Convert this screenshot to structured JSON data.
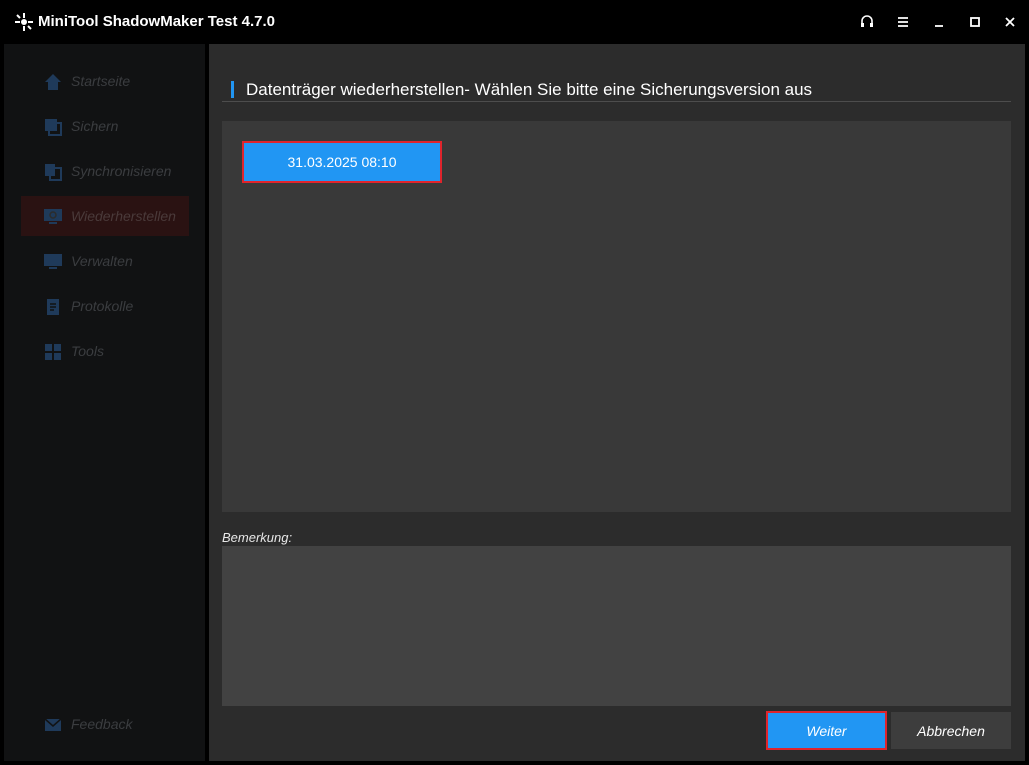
{
  "window": {
    "title": "MiniTool ShadowMaker Test 4.7.0",
    "controls": [
      "headset-icon",
      "menu-icon",
      "minimize-icon",
      "maximize-icon",
      "close-icon"
    ]
  },
  "sidebar": {
    "items": [
      {
        "label": "Startseite",
        "icon": "home-icon",
        "active": false
      },
      {
        "label": "Sichern",
        "icon": "backup-icon",
        "active": false
      },
      {
        "label": "Synchronisieren",
        "icon": "sync-icon",
        "active": false
      },
      {
        "label": "Wiederherstellen",
        "icon": "restore-icon",
        "active": true
      },
      {
        "label": "Verwalten",
        "icon": "manage-icon",
        "active": false
      },
      {
        "label": "Protokolle",
        "icon": "logs-icon",
        "active": false
      },
      {
        "label": "Tools",
        "icon": "tools-icon",
        "active": false
      }
    ],
    "feedback": {
      "label": "Feedback",
      "icon": "mail-icon"
    }
  },
  "main": {
    "heading": "Datenträger wiederherstellen- Wählen Sie bitte eine Sicherungsversion aus",
    "versions": [
      "31.03.2025 08:10"
    ],
    "remark_label": "Bemerkung:",
    "remark_value": ""
  },
  "buttons": {
    "next": "Weiter",
    "cancel": "Abbrechen"
  },
  "colors": {
    "accent": "#2196f3",
    "highlight": "#e0242c",
    "panel": "#393939"
  }
}
